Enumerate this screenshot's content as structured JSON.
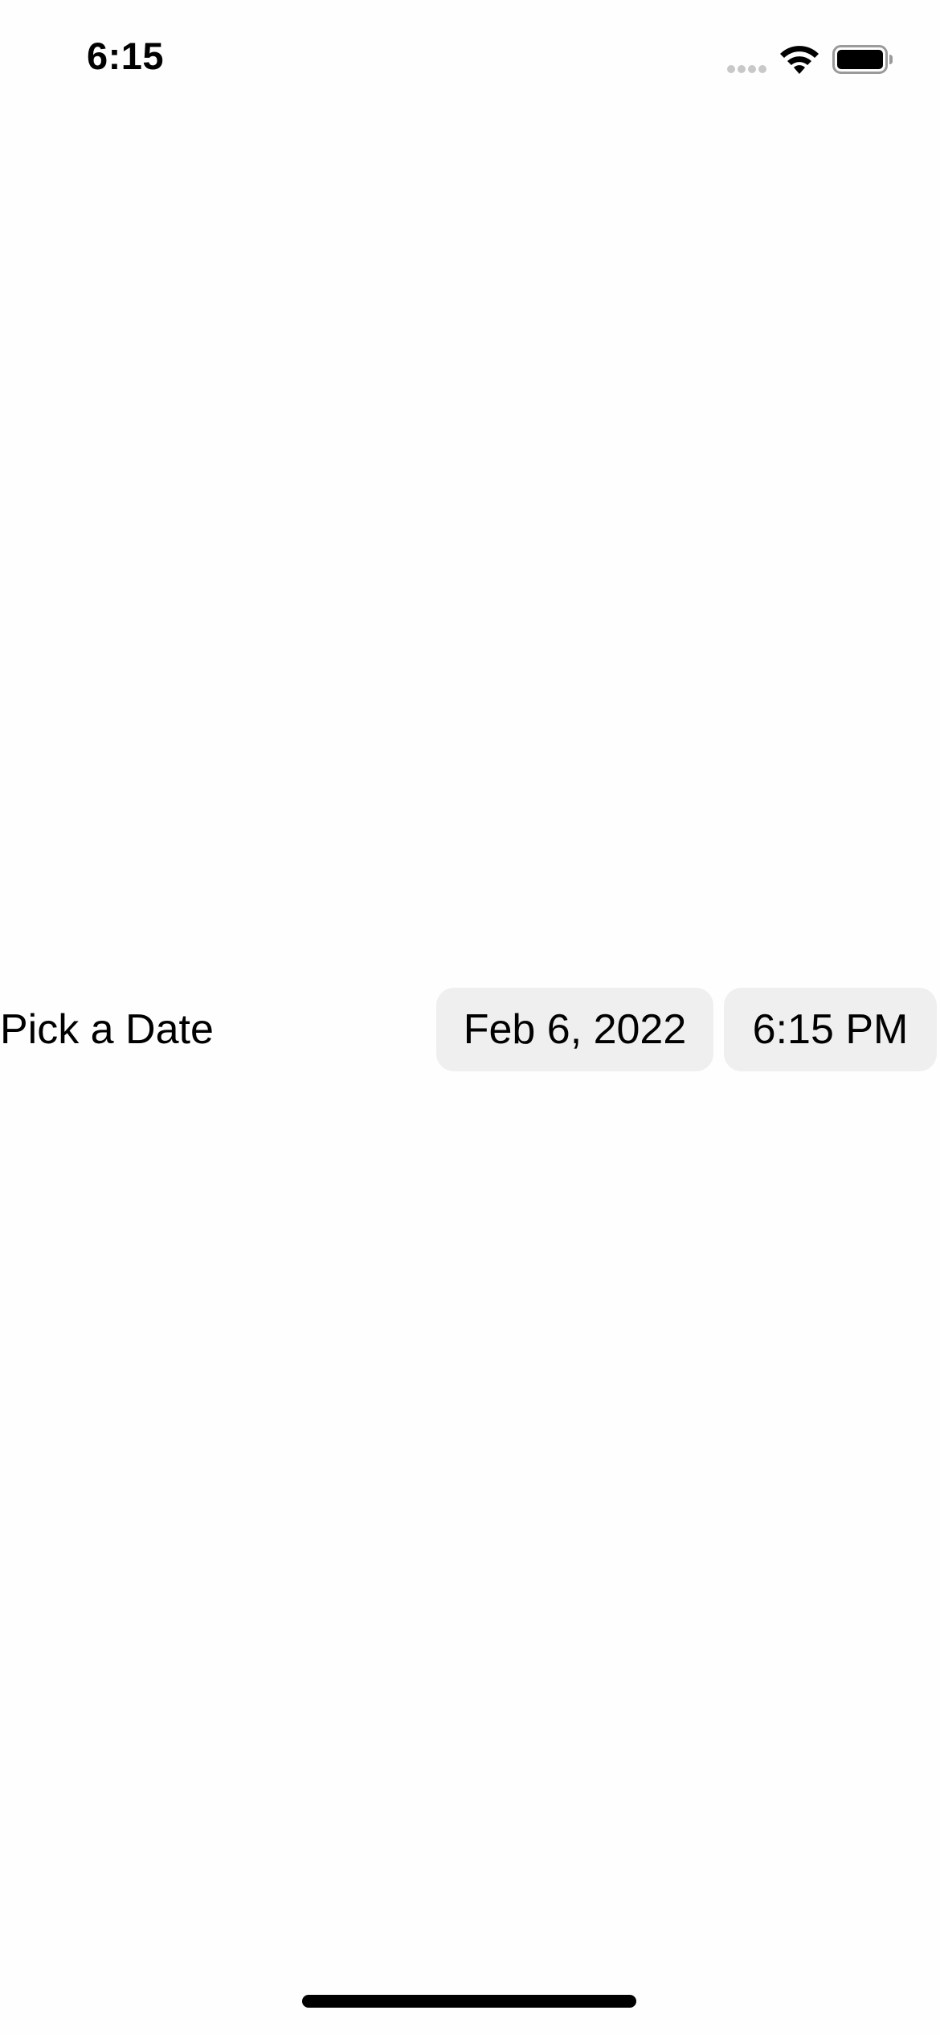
{
  "status_bar": {
    "time": "6:15",
    "icons": [
      "signal-icon",
      "wifi-icon",
      "battery-icon"
    ]
  },
  "date_picker": {
    "label": "Pick a Date",
    "date_value": "Feb 6, 2022",
    "time_value": "6:15 PM"
  },
  "colors": {
    "background": "#fefefe",
    "pill_background": "#efefef",
    "text": "#000000"
  }
}
